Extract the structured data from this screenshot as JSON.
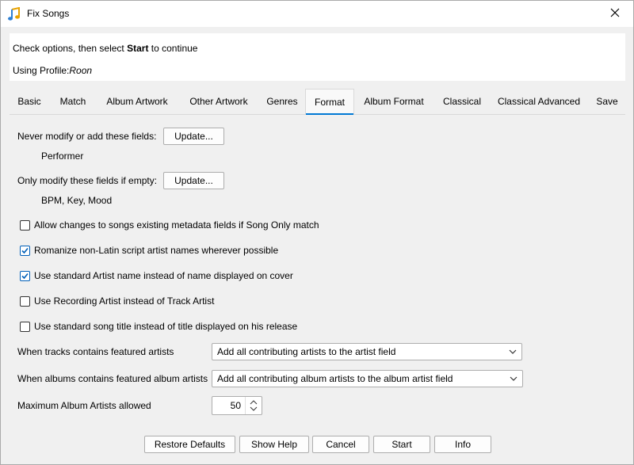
{
  "window": {
    "title": "Fix Songs"
  },
  "header": {
    "instruction_pre": "Check options, then select ",
    "instruction_bold": "Start",
    "instruction_post": " to continue",
    "profile_label": "Using Profile:",
    "profile_name": "Roon"
  },
  "tabs": [
    {
      "label": "Basic"
    },
    {
      "label": "Match"
    },
    {
      "label": "Album Artwork"
    },
    {
      "label": "Other Artwork"
    },
    {
      "label": "Genres"
    },
    {
      "label": "Format",
      "active": true
    },
    {
      "label": "Album Format"
    },
    {
      "label": "Classical"
    },
    {
      "label": "Classical Advanced"
    },
    {
      "label": "Save"
    }
  ],
  "format": {
    "never_modify_label": "Never modify or add these fields:",
    "never_modify_button": "Update...",
    "never_modify_value": "Performer",
    "only_if_empty_label": "Only modify these fields if empty:",
    "only_if_empty_button": "Update...",
    "only_if_empty_value": "BPM, Key, Mood",
    "options": [
      {
        "label": "Allow changes to songs existing metadata fields if Song Only match",
        "checked": false
      },
      {
        "label": "Romanize non-Latin script artist names wherever possible",
        "checked": true
      },
      {
        "label": "Use standard Artist name instead of name displayed on cover",
        "checked": true
      },
      {
        "label": "Use Recording Artist instead of Track Artist",
        "checked": false
      },
      {
        "label": "Use standard song title instead of title displayed on his release",
        "checked": false
      }
    ],
    "featured_tracks_label": "When tracks contains featured artists",
    "featured_tracks_value": "Add all contributing artists to the artist field",
    "featured_albums_label": "When albums contains featured album artists",
    "featured_albums_value": "Add all contributing album artists to the album artist field",
    "max_album_artists_label": "Maximum Album Artists allowed",
    "max_album_artists_value": "50"
  },
  "footer": {
    "restore_defaults": "Restore Defaults",
    "show_help": "Show Help",
    "cancel": "Cancel",
    "start": "Start",
    "info": "Info"
  },
  "colors": {
    "accent": "#0078d4",
    "checkbox": "#005fb8"
  },
  "icons": {
    "app": "music-note-icon",
    "close": "close-icon",
    "check": "checkmark-icon",
    "dropdown": "chevron-down-icon",
    "spin": "spin-arrows-icon"
  }
}
